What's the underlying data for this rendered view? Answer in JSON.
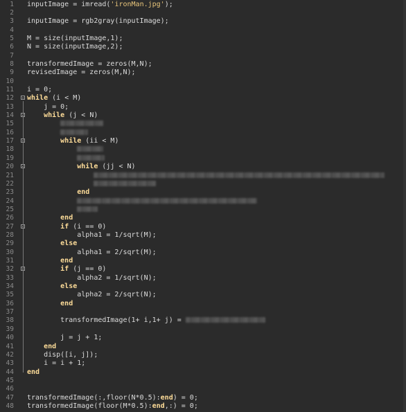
{
  "editor": {
    "lines": [
      {
        "n": "1",
        "code": [
          {
            "t": "inputImage = imread(",
            "c": "tx"
          },
          {
            "t": "'ironMan.jpg'",
            "c": "str"
          },
          {
            "t": ");",
            "c": "tx"
          }
        ]
      },
      {
        "n": "2",
        "code": []
      },
      {
        "n": "3",
        "code": [
          {
            "t": "inputImage = rgb2gray(inputImage);",
            "c": "tx"
          }
        ]
      },
      {
        "n": "4",
        "code": []
      },
      {
        "n": "5",
        "code": [
          {
            "t": "M = size(inputImage,1);",
            "c": "tx"
          }
        ]
      },
      {
        "n": "6",
        "code": [
          {
            "t": "N = size(inputImage,2);",
            "c": "tx"
          }
        ]
      },
      {
        "n": "7",
        "code": []
      },
      {
        "n": "8",
        "code": [
          {
            "t": "transformedImage = zeros(M,N);",
            "c": "tx"
          }
        ]
      },
      {
        "n": "9",
        "code": [
          {
            "t": "revisedImage = zeros(M,N);",
            "c": "tx"
          }
        ]
      },
      {
        "n": "10",
        "code": []
      },
      {
        "n": "11",
        "code": [
          {
            "t": "i = 0;",
            "c": "tx"
          }
        ]
      },
      {
        "n": "12",
        "fold": true,
        "code": [
          {
            "t": "while",
            "c": "kw"
          },
          {
            "t": " (i < M)",
            "c": "tx"
          }
        ]
      },
      {
        "n": "13",
        "code": [
          {
            "t": "    j = 0;",
            "c": "tx"
          }
        ]
      },
      {
        "n": "14",
        "fold": true,
        "code": [
          {
            "t": "    ",
            "c": "tx"
          },
          {
            "t": "while",
            "c": "kw"
          },
          {
            "t": " (j < N)",
            "c": "tx"
          }
        ]
      },
      {
        "n": "15",
        "code": [
          {
            "t": "        ",
            "c": "tx"
          },
          {
            "b": 62
          }
        ]
      },
      {
        "n": "16",
        "code": [
          {
            "t": "        ",
            "c": "tx"
          },
          {
            "b": 40
          }
        ]
      },
      {
        "n": "17",
        "fold": true,
        "code": [
          {
            "t": "        ",
            "c": "tx"
          },
          {
            "t": "while",
            "c": "kw"
          },
          {
            "t": " (ii < M)",
            "c": "tx"
          }
        ]
      },
      {
        "n": "18",
        "code": [
          {
            "t": "            ",
            "c": "tx"
          },
          {
            "b": 38
          }
        ]
      },
      {
        "n": "19",
        "code": [
          {
            "t": "            ",
            "c": "tx"
          },
          {
            "b": 40
          }
        ]
      },
      {
        "n": "20",
        "fold": true,
        "code": [
          {
            "t": "            ",
            "c": "tx"
          },
          {
            "t": "while",
            "c": "kw"
          },
          {
            "t": " (jj < N)",
            "c": "tx"
          }
        ]
      },
      {
        "n": "21",
        "code": [
          {
            "t": "                ",
            "c": "tx"
          },
          {
            "b": 420
          }
        ]
      },
      {
        "n": "22",
        "code": [
          {
            "t": "                ",
            "c": "tx"
          },
          {
            "b": 90
          }
        ]
      },
      {
        "n": "23",
        "code": [
          {
            "t": "            end",
            "c": "kw"
          }
        ]
      },
      {
        "n": "24",
        "code": [
          {
            "t": "            ",
            "c": "tx"
          },
          {
            "b": 260
          }
        ]
      },
      {
        "n": "25",
        "code": [
          {
            "t": "            ",
            "c": "tx"
          },
          {
            "b": 30
          }
        ]
      },
      {
        "n": "26",
        "code": [
          {
            "t": "        end",
            "c": "kw"
          }
        ]
      },
      {
        "n": "27",
        "fold": true,
        "code": [
          {
            "t": "        ",
            "c": "tx"
          },
          {
            "t": "if",
            "c": "kw"
          },
          {
            "t": " (i == 0)",
            "c": "tx"
          }
        ]
      },
      {
        "n": "28",
        "code": [
          {
            "t": "            alpha1 = 1/sqrt(M);",
            "c": "tx"
          }
        ]
      },
      {
        "n": "29",
        "code": [
          {
            "t": "        else",
            "c": "kw"
          }
        ]
      },
      {
        "n": "30",
        "code": [
          {
            "t": "            alpha1 = 2/sqrt(M);",
            "c": "tx"
          }
        ]
      },
      {
        "n": "31",
        "code": [
          {
            "t": "        end",
            "c": "kw"
          }
        ]
      },
      {
        "n": "32",
        "fold": true,
        "code": [
          {
            "t": "        ",
            "c": "tx"
          },
          {
            "t": "if",
            "c": "kw"
          },
          {
            "t": " (j == 0)",
            "c": "tx"
          }
        ]
      },
      {
        "n": "33",
        "code": [
          {
            "t": "            alpha2 = 1/sqrt(N);",
            "c": "tx"
          }
        ]
      },
      {
        "n": "34",
        "code": [
          {
            "t": "        else",
            "c": "kw"
          }
        ]
      },
      {
        "n": "35",
        "code": [
          {
            "t": "            alpha2 = 2/sqrt(N);",
            "c": "tx"
          }
        ]
      },
      {
        "n": "36",
        "code": [
          {
            "t": "        end",
            "c": "kw"
          }
        ]
      },
      {
        "n": "37",
        "code": []
      },
      {
        "n": "38",
        "code": [
          {
            "t": "        transformedImage(1+ i,1+ j) = ",
            "c": "tx"
          },
          {
            "b": 115
          }
        ]
      },
      {
        "n": "39",
        "code": []
      },
      {
        "n": "40",
        "code": [
          {
            "t": "        j = j + 1;",
            "c": "tx"
          }
        ]
      },
      {
        "n": "41",
        "code": [
          {
            "t": "    end",
            "c": "kw"
          }
        ]
      },
      {
        "n": "42",
        "code": [
          {
            "t": "    disp([i, j]);",
            "c": "tx"
          }
        ]
      },
      {
        "n": "43",
        "code": [
          {
            "t": "    i = i + 1;",
            "c": "tx"
          }
        ]
      },
      {
        "n": "44",
        "code": [
          {
            "t": "end",
            "c": "kw"
          }
        ]
      },
      {
        "n": "45",
        "code": []
      },
      {
        "n": "46",
        "code": []
      },
      {
        "n": "47",
        "code": [
          {
            "t": "transformedImage(:,floor(N*0.5):",
            "c": "tx"
          },
          {
            "t": "end",
            "c": "kw"
          },
          {
            "t": ") = 0;",
            "c": "tx"
          }
        ]
      },
      {
        "n": "48",
        "code": [
          {
            "t": "transformedImage(floor(M*0.5):",
            "c": "tx"
          },
          {
            "t": "end",
            "c": "kw"
          },
          {
            "t": ",:) = 0;",
            "c": "tx"
          }
        ]
      }
    ]
  },
  "colors": {
    "background": "#2b2b2b",
    "text": "#dcdcdc",
    "keyword": "#ffdd99",
    "string": "#e7c47a",
    "line_number": "#8a8a8a"
  }
}
